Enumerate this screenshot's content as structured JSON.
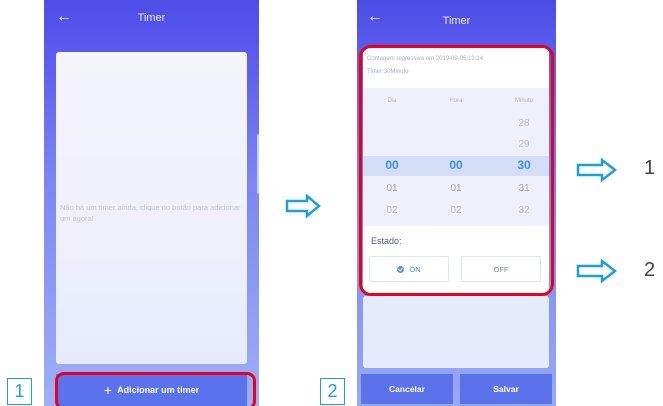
{
  "screen1": {
    "back_icon": "arrow-left-icon",
    "title": "Timer",
    "empty_message": "Não há um timer ainda, clique no botão para adicionar um agora!",
    "add_button_label": "Adicionar um timer",
    "step_number": "1"
  },
  "screen2": {
    "back_icon": "arrow-left-icon",
    "title": "Timer",
    "scheduled_text": "Contagem regressiva em:2019-09-05 13:14",
    "timer_text": "Timer:30Minuto",
    "columns": [
      "Dia",
      "Hora",
      "Minuto"
    ],
    "picker": {
      "dia": [
        "00",
        "01",
        "02"
      ],
      "hora": [
        "00",
        "01",
        "02"
      ],
      "minuto": [
        "28",
        "29",
        "30",
        "31",
        "32"
      ],
      "selected": {
        "dia": "00",
        "hora": "00",
        "minuto": "30"
      }
    },
    "estado_label": "Estado:",
    "on_label": "ON",
    "off_label": "OFF",
    "selected_state": "ON",
    "cancel_label": "Cancelar",
    "save_label": "Salvar",
    "step_number": "2"
  },
  "callouts": {
    "first": "1",
    "second": "2"
  },
  "colors": {
    "highlight": "#e8001c",
    "accent": "#1c9fe0",
    "primary_button": "#5b72eb"
  }
}
